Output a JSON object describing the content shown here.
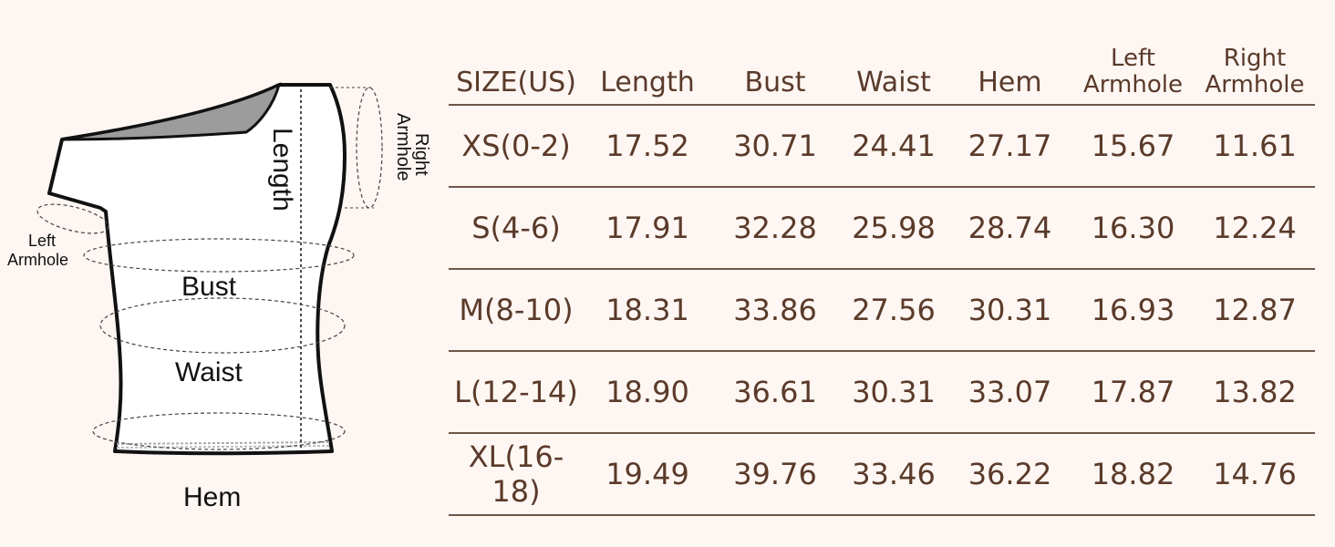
{
  "diagram": {
    "labels": {
      "length": "Length",
      "right_armhole": [
        "Right",
        "Armhole"
      ],
      "left_armhole": [
        "Left",
        "Armhole"
      ],
      "bust": "Bust",
      "waist": "Waist",
      "hem": "Hem"
    }
  },
  "table": {
    "headers": [
      "SIZE(US)",
      "Length",
      "Bust",
      "Waist",
      "Hem",
      [
        "Left",
        "Armhole"
      ],
      [
        "Right",
        "Armhole"
      ]
    ],
    "rows": [
      [
        "XS(0-2)",
        "17.52",
        "30.71",
        "24.41",
        "27.17",
        "15.67",
        "11.61"
      ],
      [
        "S(4-6)",
        "17.91",
        "32.28",
        "25.98",
        "28.74",
        "16.30",
        "12.24"
      ],
      [
        "M(8-10)",
        "18.31",
        "33.86",
        "27.56",
        "30.31",
        "16.93",
        "12.87"
      ],
      [
        "L(12-14)",
        "18.90",
        "36.61",
        "30.31",
        "33.07",
        "17.87",
        "13.82"
      ],
      [
        "XL(16-18)",
        "19.49",
        "39.76",
        "33.46",
        "36.22",
        "18.82",
        "14.76"
      ]
    ]
  },
  "colors": {
    "background": "#fdf6f2",
    "text": "#5a3a2a",
    "rule": "#6e5548"
  }
}
